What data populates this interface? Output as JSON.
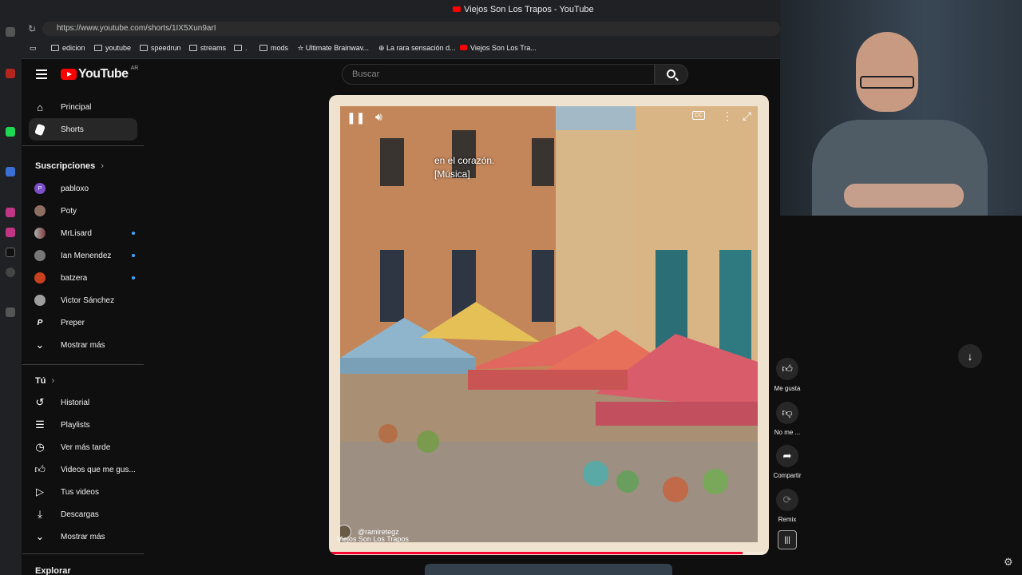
{
  "browser": {
    "window_title": "Viejos Son Los Trapos - YouTube",
    "url": "https://www.youtube.com/shorts/1IX5Xun9arI",
    "bookmarks": [
      "edicion",
      "youtube",
      "speedrun",
      "streams",
      ".",
      "mods",
      "Ultimate Brainwav...",
      "La rara sensación d...",
      "Viejos Son Los Tra..."
    ]
  },
  "header": {
    "logo_text": "YouTube",
    "country_code": "AR",
    "search_placeholder": "Buscar"
  },
  "sidebar": {
    "main": [
      {
        "label": "Principal",
        "icon": "home-icon"
      },
      {
        "label": "Shorts",
        "icon": "shorts-icon",
        "active": true
      }
    ],
    "subscriptions_title": "Suscripciones",
    "subscriptions": [
      {
        "label": "pabloxo",
        "avatar_color": "#7b4fc9",
        "initial": "P",
        "new": false
      },
      {
        "label": "Poty",
        "avatar_color": "#8d6e63",
        "new": false
      },
      {
        "label": "MrLisard",
        "avatar_color": "#b0b0b0",
        "new": true
      },
      {
        "label": "Ian Menendez",
        "avatar_color": "#777777",
        "new": true
      },
      {
        "label": "batzera",
        "avatar_color": "#c8411e",
        "new": true
      },
      {
        "label": "Victor Sánchez",
        "avatar_color": "#9e9e9e",
        "new": false
      },
      {
        "label": "Preper",
        "avatar_color": "#0f0f0f",
        "initial": "P",
        "new": false
      }
    ],
    "show_more_1": "Mostrar más",
    "you_title": "Tú",
    "you_items": [
      {
        "label": "Historial",
        "icon": "history-icon"
      },
      {
        "label": "Playlists",
        "icon": "playlists-icon"
      },
      {
        "label": "Ver más tarde",
        "icon": "watch-later-icon"
      },
      {
        "label": "Videos que me gus...",
        "icon": "like-icon"
      },
      {
        "label": "Tus videos",
        "icon": "your-videos-icon"
      },
      {
        "label": "Descargas",
        "icon": "download-icon"
      }
    ],
    "show_more_2": "Mostrar más",
    "explore_title": "Explorar"
  },
  "player": {
    "caption_line1": "en el corazón.",
    "caption_line2": "[Música]",
    "channel": "@ramiretegz",
    "title": "Viejos Son Los Trapos",
    "progress": 0.94
  },
  "actions": {
    "like": "Me gusta",
    "dislike": "No me ...",
    "share": "Compartir",
    "remix": "Remix"
  },
  "colors": {
    "brand_red": "#ff0000",
    "accent_blue": "#3ea6ff"
  }
}
